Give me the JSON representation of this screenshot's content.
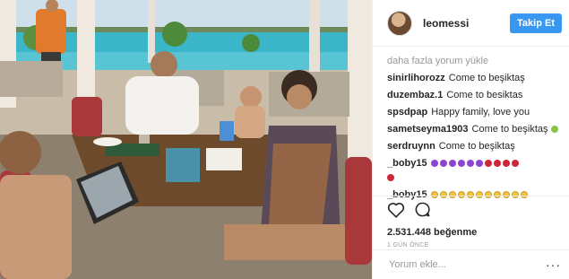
{
  "header": {
    "username": "leomessi",
    "follow_label": "Takip Et"
  },
  "comments": {
    "load_more": "daha fazla yorum yükle",
    "items": [
      {
        "user": "sinirlihorozz",
        "text": "Come to beşiktaş"
      },
      {
        "user": "duzembaz.1",
        "text": "Come to besiktas"
      },
      {
        "user": "spsdpap",
        "text": "Happy family, love you"
      },
      {
        "user": "sametseyma1903",
        "text": "Come to beşiktaş"
      },
      {
        "user": "serdruynn",
        "text": "Come to beşiktaş"
      },
      {
        "user": "_boby15",
        "text": ""
      },
      {
        "user": "_boby15",
        "text": ""
      }
    ]
  },
  "post": {
    "likes": "2.531.448 beğenme",
    "time": "1 GÜN ÖNCE"
  },
  "add_comment": {
    "placeholder": "Yorum ekle...",
    "more": "···"
  },
  "icons": {
    "like": "heart-icon",
    "comment": "comment-icon",
    "more": "more-options-icon"
  },
  "colors": {
    "follow_button": "#3897f0",
    "muted_text": "#999999",
    "text": "#262626"
  }
}
